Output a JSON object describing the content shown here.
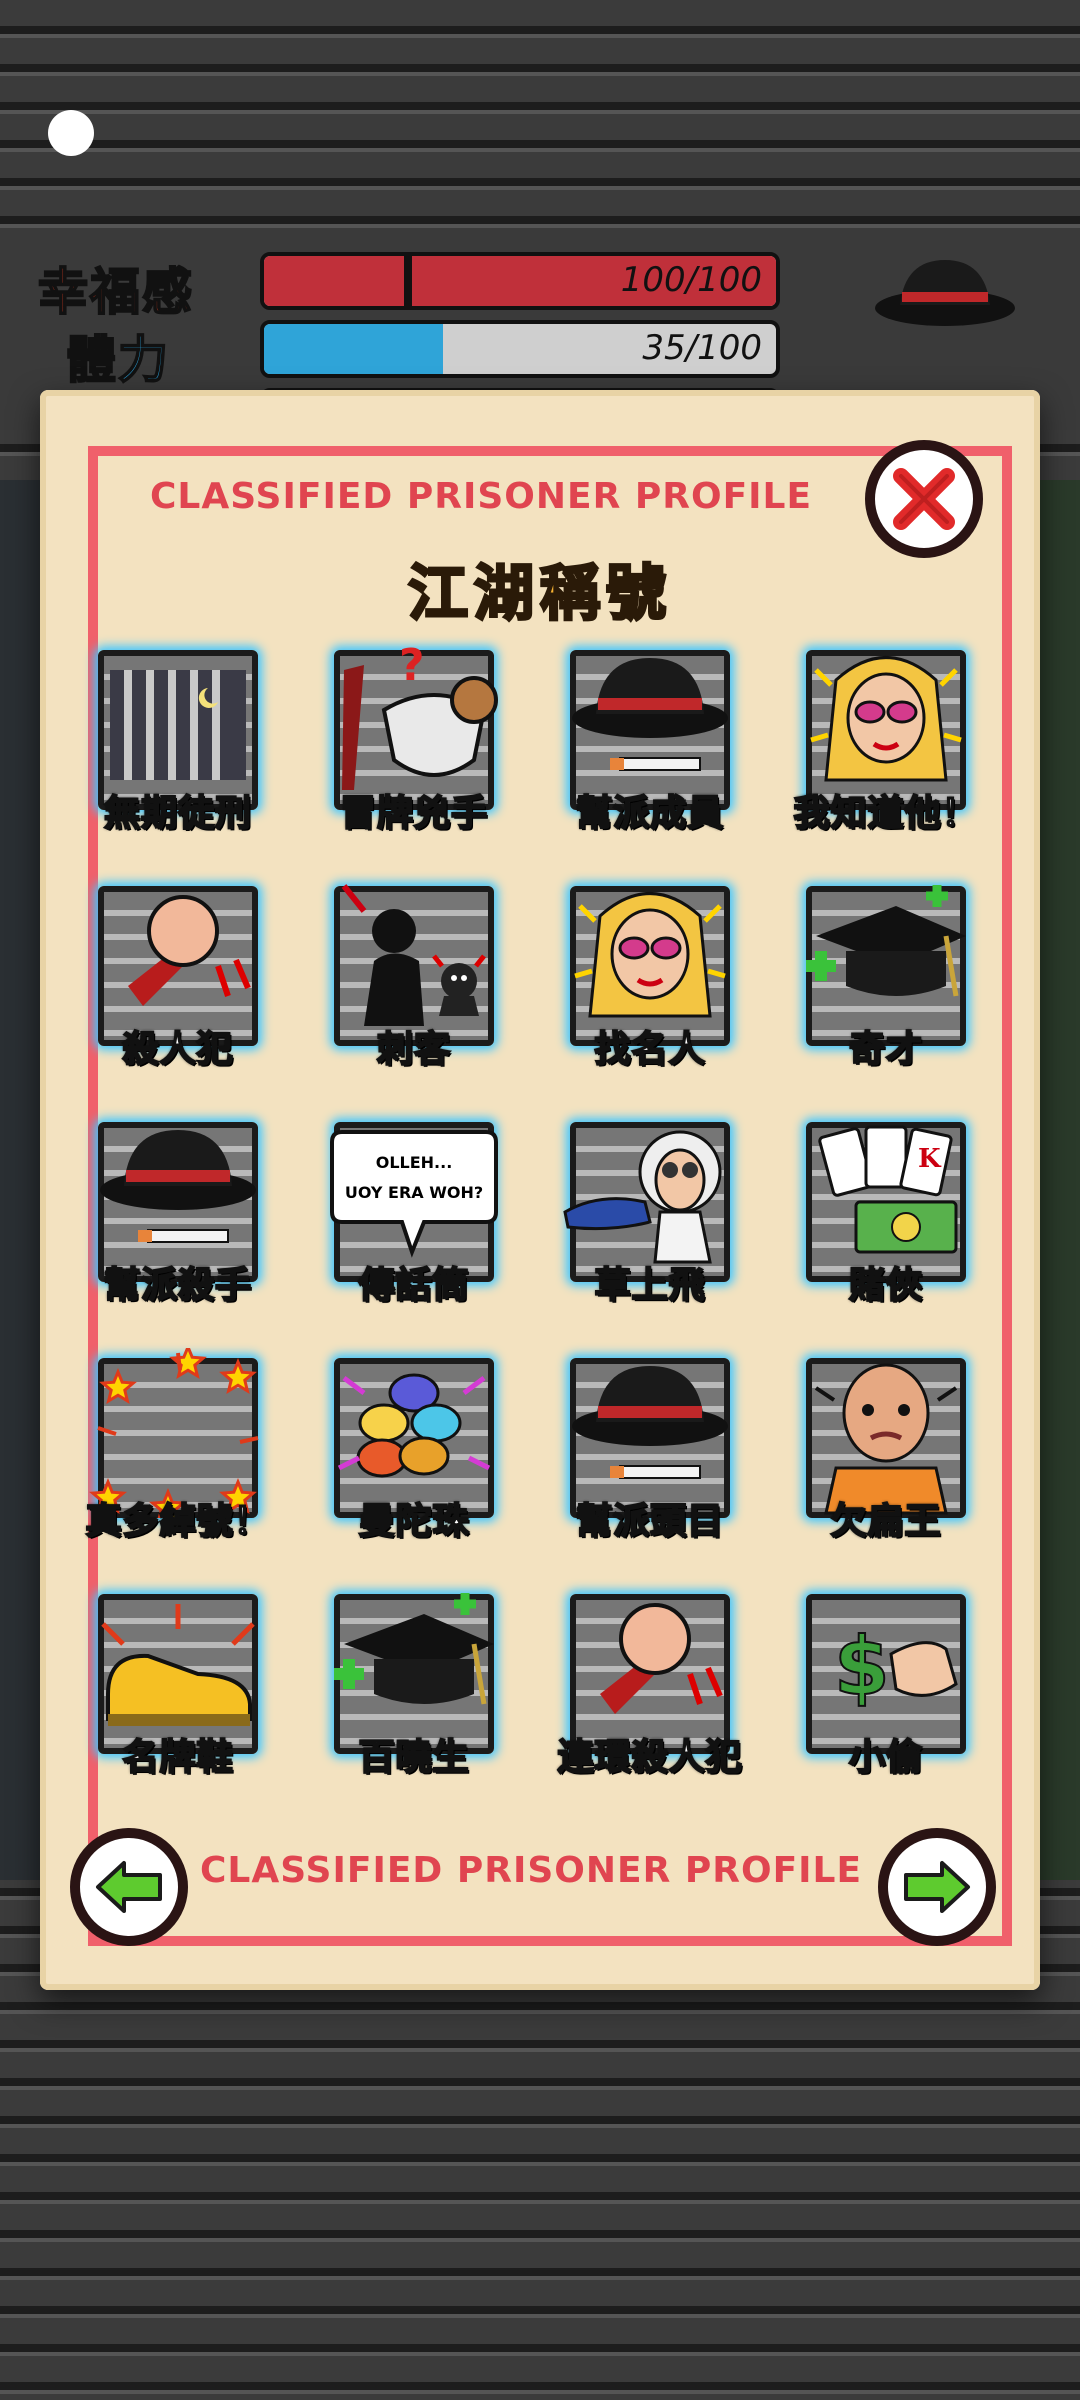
{
  "hud": {
    "stats": [
      {
        "label": "幸福感",
        "value": "100/100",
        "fill": 1.0,
        "color": "#c0303a",
        "label_color": "#d23a1f"
      },
      {
        "label": "體力",
        "value": "35/100",
        "fill": 0.35,
        "color": "#2fa4d8",
        "label_color": "#2a9fd8"
      },
      {
        "label": "",
        "value": "",
        "fill": 0.6,
        "color": "#4cbf3a",
        "label_color": "#4caf50"
      }
    ]
  },
  "dialog": {
    "header": "CLASSIFIED PRISONER PROFILE",
    "subtitle": "江湖稱號",
    "footer": "CLASSIFIED PRISONER PROFILE",
    "titles": [
      {
        "label": "無期徒刑",
        "icon": "prison-cell-icon",
        "gold": true
      },
      {
        "label": "冒牌兇手",
        "icon": "goat-knife-icon",
        "gold": false
      },
      {
        "label": "幫派成員",
        "icon": "gangster-hat-icon",
        "gold": false
      },
      {
        "label": "我知道他！",
        "icon": "celebrity-woman-icon",
        "gold": false
      },
      {
        "label": "殺人犯",
        "icon": "fist-knife-icon",
        "gold": false
      },
      {
        "label": "刺客",
        "icon": "assassin-silhouette-icon",
        "gold": false
      },
      {
        "label": "找名人",
        "icon": "celebrity-woman-icon",
        "gold": false
      },
      {
        "label": "奇才",
        "icon": "graduation-cap-icon",
        "gold": false
      },
      {
        "label": "幫派殺手",
        "icon": "gangster-hat-icon",
        "gold": false
      },
      {
        "label": "傳話筒",
        "icon": "speech-bubble-icon",
        "gold": false
      },
      {
        "label": "草上飛",
        "icon": "scientist-sneaker-icon",
        "gold": false
      },
      {
        "label": "賭俠",
        "icon": "cards-money-icon",
        "gold": false
      },
      {
        "label": "真多綽號！",
        "icon": "stars-icon",
        "gold": false
      },
      {
        "label": "曼陀珠",
        "icon": "candies-icon",
        "gold": false
      },
      {
        "label": "幫派頭目",
        "icon": "gangster-hat-icon",
        "gold": false
      },
      {
        "label": "欠扁王",
        "icon": "bald-prisoner-icon",
        "gold": false
      },
      {
        "label": "名牌鞋",
        "icon": "gold-shoe-icon",
        "gold": false
      },
      {
        "label": "百曉生",
        "icon": "graduation-cap-icon",
        "gold": false
      },
      {
        "label": "連環殺人犯",
        "icon": "fist-knife-icon",
        "gold": false
      },
      {
        "label": "小偷",
        "icon": "money-hand-icon",
        "gold": false
      }
    ],
    "speech_bubble": [
      "OLLEH...",
      "UOY ERA WOH?"
    ]
  }
}
